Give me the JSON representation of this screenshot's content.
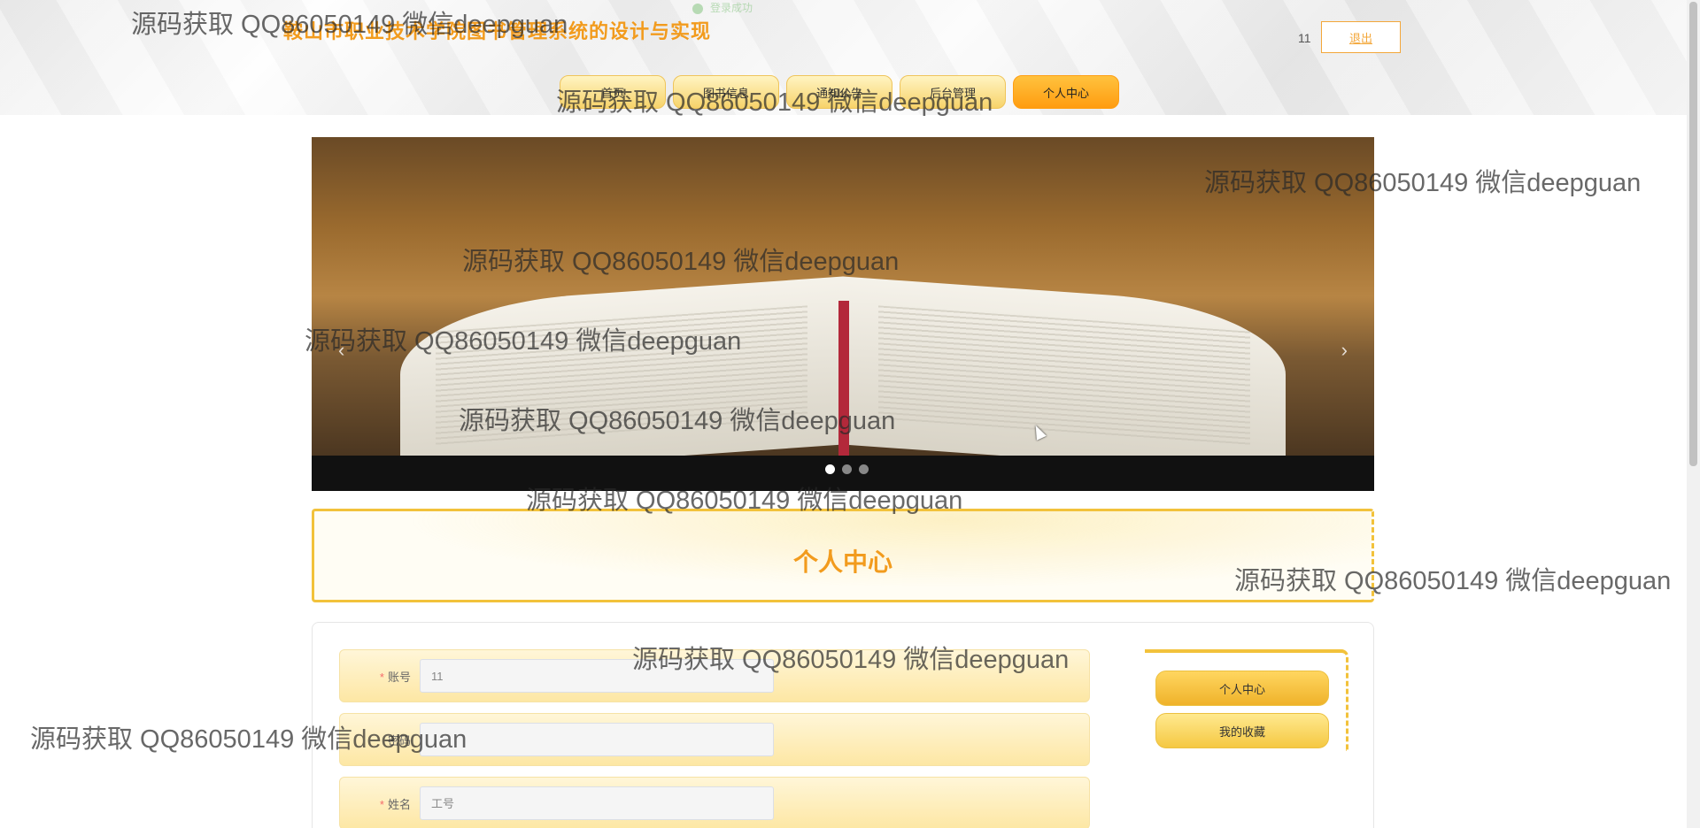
{
  "header": {
    "site_title": "鞍山市职业技术学院图书管理系统的设计与实现",
    "toast": "登录成功",
    "username": "11",
    "logout_label": "退出"
  },
  "nav": {
    "items": [
      {
        "label": "首页"
      },
      {
        "label": "图书信息"
      },
      {
        "label": "通知公告"
      },
      {
        "label": "后台管理"
      },
      {
        "label": "个人中心"
      }
    ]
  },
  "carousel": {
    "prev": "‹",
    "next": "›"
  },
  "section": {
    "title": "个人中心"
  },
  "form": {
    "fields": [
      {
        "label": "账号",
        "value": "11",
        "required": "*"
      },
      {
        "label": "密码",
        "value": "",
        "required": ""
      },
      {
        "label": "姓名",
        "value": "工号",
        "required": "*"
      }
    ]
  },
  "side": {
    "personal_center": "个人中心",
    "my_favorites": "我的收藏"
  },
  "watermarks": [
    "源码获取 QQ86050149 微信deepguan",
    "源码获取 QQ86050149 微信deepguan",
    "源码获取 QQ86050149 微信deepguan",
    "源码获取 QQ86050149 微信deepguan",
    "源码获取 QQ86050149 微信deepguan",
    "源码获取 QQ86050149 微信deepguan",
    "源码获取 QQ86050149 微信deepguan",
    "源码获取 QQ86050149 微信deepguan",
    "源码获取 QQ86050149 微信deepguan",
    "源码获取 QQ86050149 微信deepguan"
  ],
  "colors": {
    "accent": "#f29b1d",
    "nav_active": "#ff9c10",
    "border": "#f2c23b"
  }
}
